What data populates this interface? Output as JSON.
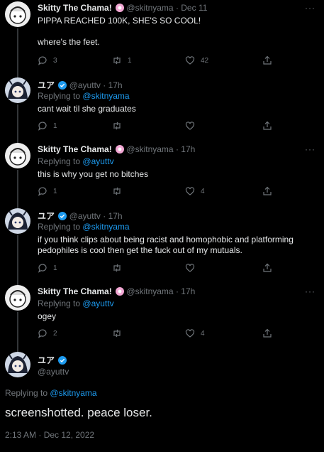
{
  "tweets": [
    {
      "name": "Skitty The Chama!",
      "handle": "@skitnyama",
      "time": "· Dec 11",
      "badge": "flower",
      "replying_label": "",
      "replying_to": "",
      "text_lines": [
        "PIPPA REACHED 100K, SHE'S SO COOL!",
        "",
        "where's the feet."
      ],
      "reply_count": "3",
      "retweet_count": "1",
      "like_count": "42"
    },
    {
      "name": "ユア",
      "handle": "@ayuttv",
      "time": "· 17h",
      "badge": "verified",
      "replying_label": "Replying to",
      "replying_to": "@skitnyama",
      "text_lines": [
        "cant wait til she graduates"
      ],
      "reply_count": "1",
      "retweet_count": "",
      "like_count": ""
    },
    {
      "name": "Skitty The Chama!",
      "handle": "@skitnyama",
      "time": "· 17h",
      "badge": "flower",
      "replying_label": "Replying to",
      "replying_to": "@ayuttv",
      "text_lines": [
        "this is why you get no bitches"
      ],
      "reply_count": "1",
      "retweet_count": "",
      "like_count": "4"
    },
    {
      "name": "ユア",
      "handle": "@ayuttv",
      "time": "· 17h",
      "badge": "verified",
      "replying_label": "Replying to",
      "replying_to": "@skitnyama",
      "text_lines": [
        "if you think clips about being racist and homophobic and platforming",
        "pedophiles is cool then get the fuck out of my mutuals."
      ],
      "reply_count": "1",
      "retweet_count": "",
      "like_count": ""
    },
    {
      "name": "Skitty The Chama!",
      "handle": "@skitnyama",
      "time": "· 17h",
      "badge": "flower",
      "replying_label": "Replying to",
      "replying_to": "@ayuttv",
      "text_lines": [
        "ogey"
      ],
      "reply_count": "2",
      "retweet_count": "",
      "like_count": "4"
    }
  ],
  "main_tweet": {
    "name": "ユア",
    "handle": "@ayuttv",
    "replying_label": "Replying to",
    "replying_to": "@skitnyama",
    "text": "screenshotted. peace loser.",
    "timestamp": "2:13 AM · Dec 12, 2022"
  },
  "more_label": "···",
  "colors": {
    "background": "#000000",
    "text": "#e7e9ea",
    "muted": "#71767b",
    "link": "#1d9bf0",
    "verified": "#1d9bf0"
  },
  "icons": [
    "reply-icon",
    "retweet-icon",
    "like-icon",
    "share-icon",
    "more-icon",
    "verified-icon",
    "flower-badge-icon"
  ]
}
